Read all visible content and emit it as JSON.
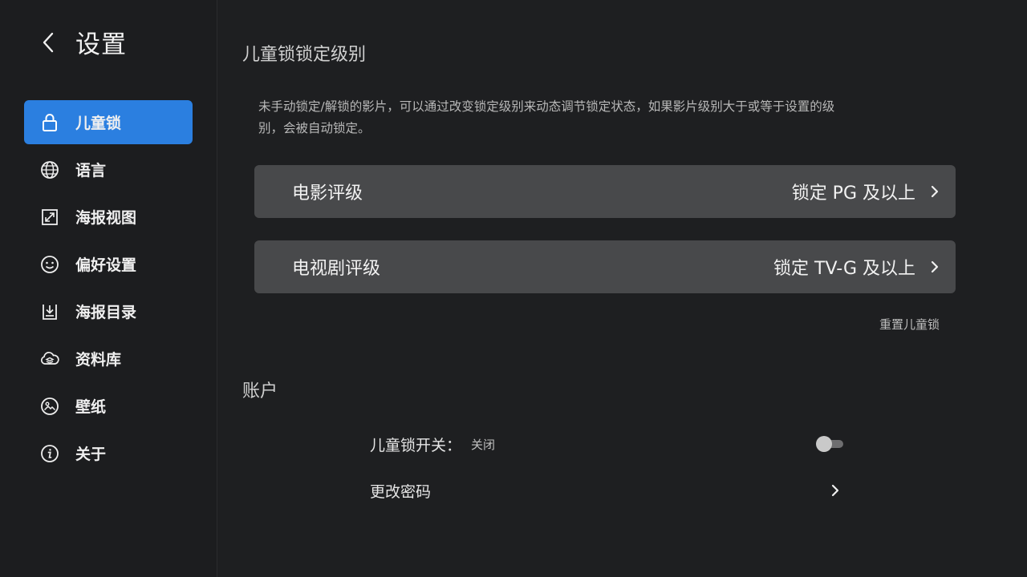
{
  "header": {
    "title": "设置",
    "back_icon": "chevron-left-icon"
  },
  "sidebar": {
    "items": [
      {
        "label": "儿童锁",
        "icon": "lock-icon",
        "active": true
      },
      {
        "label": "语言",
        "icon": "globe-icon"
      },
      {
        "label": "海报视图",
        "icon": "expand-icon"
      },
      {
        "label": "偏好设置",
        "icon": "smiley-icon"
      },
      {
        "label": "海报目录",
        "icon": "download-tray-icon"
      },
      {
        "label": "资料库",
        "icon": "cloud-layers-icon"
      },
      {
        "label": "壁纸",
        "icon": "image-icon"
      },
      {
        "label": "关于",
        "icon": "info-icon"
      }
    ]
  },
  "main": {
    "section_title": "儿童锁锁定级别",
    "description": "未手动锁定/解锁的影片，可以通过改变锁定级别来动态调节锁定状态，如果影片级别大于或等于设置的级别，会被自动锁定。",
    "ratings": [
      {
        "label": "电影评级",
        "value": "锁定 PG 及以上"
      },
      {
        "label": "电视剧评级",
        "value": "锁定 TV-G 及以上"
      }
    ],
    "reset_label": "重置儿童锁",
    "account": {
      "title": "账户",
      "lock_switch_label": "儿童锁开关：",
      "lock_switch_status": "关闭",
      "lock_switch_on": false,
      "change_password_label": "更改密码"
    }
  },
  "colors": {
    "accent": "#2b7fe0",
    "background": "#1e1f21",
    "row_bg": "#48494b"
  }
}
